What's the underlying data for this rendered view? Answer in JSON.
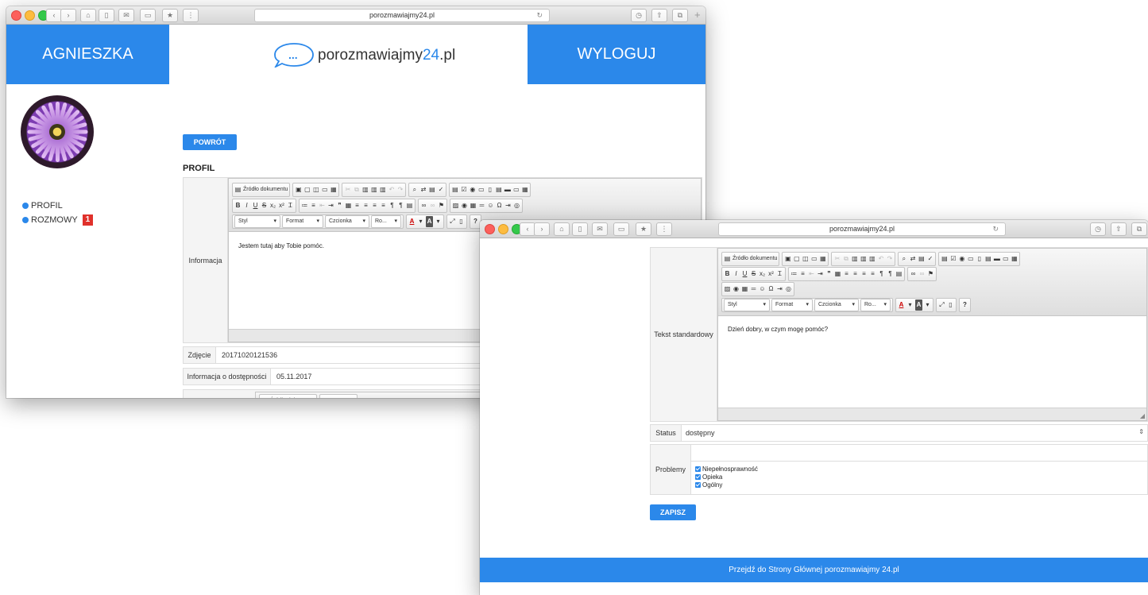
{
  "browser": {
    "url_text": "porozmawiajmy24.pl",
    "reload_icon": "reload-icon",
    "new_tab_icon": "plus-icon"
  },
  "header": {
    "user_name": "AGNIESZKA",
    "logout_label": "WYLOGUJ",
    "logo_dots": "...",
    "logo_text_main": "porozmawiajmy",
    "logo_text_accent": "24",
    "logo_text_tail": ".pl"
  },
  "sidebar": {
    "items": [
      {
        "label": "PROFIL"
      },
      {
        "label": "ROZMOWY",
        "badge": "1"
      }
    ]
  },
  "profile": {
    "back_button": "POWRÓT",
    "section_title": "PROFIL",
    "info_label": "Informacja",
    "info_text": "Jestem tutaj aby Tobie pomóc.",
    "photo_label": "Zdjęcie",
    "photo_value": "20171020121536",
    "availability_label": "Informacja o dostępności",
    "availability_value": "05.11.2017"
  },
  "editor_toolbar": {
    "source_label": "Źródło dokumentu",
    "dropdowns": [
      "Styl",
      "Format",
      "Czcionka",
      "Ro..."
    ],
    "help_label": "?"
  },
  "form2": {
    "standard_text_label": "Tekst standardowy",
    "standard_text_value": "Dzień dobry, w czym mogę pomóc?",
    "status_label": "Status",
    "status_value": "dostępny",
    "problems_label": "Problemy",
    "problems": [
      "Niepełnosprawność",
      "Opieka",
      "Ogólny"
    ],
    "save_button": "ZAPISZ"
  },
  "footer": {
    "link_text": "Przejdź do Strony Głównej porozmawiajmy 24.pl"
  },
  "colors": {
    "brand_blue": "#2b88ea",
    "badge_red": "#e0312b"
  }
}
